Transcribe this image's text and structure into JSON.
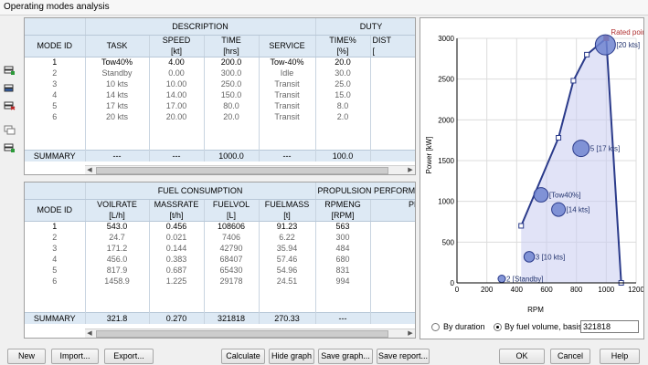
{
  "window": {
    "title": "Operating modes analysis"
  },
  "duty_table": {
    "group_headers": {
      "description": "DESCRIPTION",
      "duty": "DUTY"
    },
    "columns": [
      "MODE ID",
      "TASK",
      "SPEED",
      "TIME",
      "SERVICE",
      "TIME%",
      "DIST"
    ],
    "units": [
      "",
      "",
      "[kt]",
      "[hrs]",
      "",
      "[%]",
      "["
    ],
    "rows": [
      [
        "1",
        "Tow40%",
        "4.00",
        "200.0",
        "Tow-40%",
        "20.0",
        "80"
      ],
      [
        "2",
        "Standby",
        "0.00",
        "300.0",
        "Idle",
        "30.0",
        "0"
      ],
      [
        "3",
        "10 kts",
        "10.00",
        "250.0",
        "Transit",
        "25.0",
        "25"
      ],
      [
        "4",
        "14 kts",
        "14.00",
        "150.0",
        "Transit",
        "15.0",
        "21"
      ],
      [
        "5",
        "17 kts",
        "17.00",
        "80.0",
        "Transit",
        "8.0",
        "13"
      ],
      [
        "6",
        "20 kts",
        "20.00",
        "20.0",
        "Transit",
        "2.0",
        "40"
      ]
    ],
    "summary": [
      "SUMMARY",
      "---",
      "---",
      "1000.0",
      "---",
      "100.0",
      "71"
    ]
  },
  "fuel_table": {
    "group_headers": {
      "fuel": "FUEL CONSUMPTION",
      "propulsion": "PROPULSION PERFORM"
    },
    "columns": [
      "MODE ID",
      "VOILRATE",
      "MASSRATE",
      "FUELVOL",
      "FUELMASS",
      "RPMENG",
      "PBT"
    ],
    "units": [
      "",
      "[L/h]",
      "[t/h]",
      "[L]",
      "[t]",
      "[RPM]",
      "[k"
    ],
    "rows": [
      [
        "1",
        "543.0",
        "0.456",
        "108606",
        "91.23",
        "563",
        "21"
      ],
      [
        "2",
        "24.7",
        "0.021",
        "7406",
        "6.22",
        "300",
        "0"
      ],
      [
        "3",
        "171.2",
        "0.144",
        "42790",
        "35.94",
        "484",
        "6"
      ],
      [
        "4",
        "456.0",
        "0.383",
        "68407",
        "57.46",
        "680",
        "17"
      ],
      [
        "5",
        "817.9",
        "0.687",
        "65430",
        "54.96",
        "831",
        "32"
      ],
      [
        "6",
        "1458.9",
        "1.225",
        "29178",
        "24.51",
        "994",
        "58"
      ]
    ],
    "summary": [
      "SUMMARY",
      "321.8",
      "0.270",
      "321818",
      "270.33",
      "---",
      "---"
    ]
  },
  "chart_data": {
    "type": "scatter",
    "xlabel": "RPM",
    "ylabel": "Power [kW]",
    "xlim": [
      0,
      1200
    ],
    "ylim": [
      0,
      3000
    ],
    "xticks": [
      "0",
      "200",
      "400",
      "600",
      "800",
      "1000",
      "1200"
    ],
    "yticks": [
      "0",
      "500",
      "1000",
      "1500",
      "2000",
      "2500",
      "3000"
    ],
    "grid": true,
    "engine_envelope": [
      {
        "x": 430,
        "y": 700
      },
      {
        "x": 680,
        "y": 1780
      },
      {
        "x": 780,
        "y": 2480
      },
      {
        "x": 870,
        "y": 2800
      },
      {
        "x": 1000,
        "y": 3000
      },
      {
        "x": 1100,
        "y": 0
      }
    ],
    "rated_point": {
      "x": 1000,
      "y": 3000,
      "label": "Rated point"
    },
    "modes": [
      {
        "x": 563,
        "y": 1080,
        "label": "[Tow40%]",
        "bubble": 0.456
      },
      {
        "x": 300,
        "y": 50,
        "label": "2 [Standby]",
        "bubble": 0.021
      },
      {
        "x": 484,
        "y": 320,
        "label": "3 [10 kts]",
        "bubble": 0.144
      },
      {
        "x": 680,
        "y": 900,
        "label": "[14 kts]",
        "bubble": 0.383
      },
      {
        "x": 831,
        "y": 1650,
        "label": "5 [17 kts]",
        "bubble": 0.687
      },
      {
        "x": 994,
        "y": 2920,
        "label": "[20 kts]",
        "bubble": 1.225
      }
    ],
    "colors": {
      "line": "#2a3a8a",
      "fill": "#c8ccf0",
      "bubble": "#6e84d0",
      "rated": "#b03030"
    }
  },
  "graph_options": {
    "by_duration": "By duration",
    "by_fuel": "By fuel volume, basis:",
    "basis_value": "321818",
    "selected": "fuel"
  },
  "buttons": {
    "new": "New",
    "import": "Import...",
    "export": "Export...",
    "calculate": "Calculate",
    "hide_graph": "Hide graph",
    "save_graph": "Save graph...",
    "save_report": "Save report...",
    "ok": "OK",
    "cancel": "Cancel",
    "help": "Help"
  },
  "icons": [
    "add-row-icon",
    "insert-row-icon",
    "delete-row-icon",
    "copy-row-icon",
    "paste-row-icon"
  ]
}
